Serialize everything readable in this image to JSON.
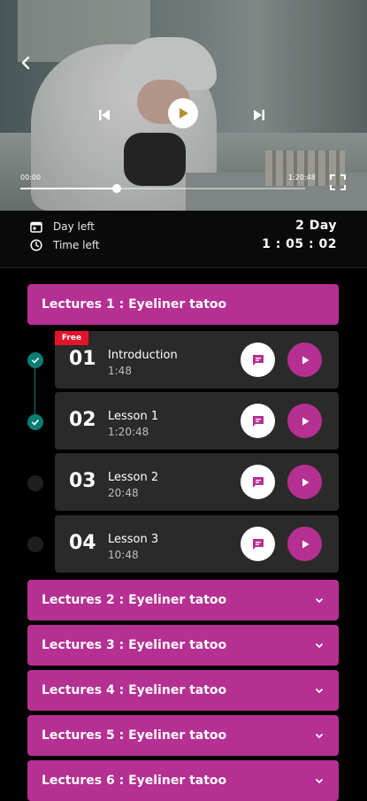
{
  "player": {
    "current_time": "00:00",
    "total_time": "1:20:48",
    "progress_fraction": 0.34
  },
  "info": {
    "day_left_label": "Day left",
    "day_left_value": "2  Day",
    "time_left_label": "Time left",
    "time_left_value": "1 : 05 : 02"
  },
  "expanded_section": {
    "title": "Lectures 1 : Eyeliner tatoo",
    "free_badge": "Free",
    "lessons": [
      {
        "number": "01",
        "title": "Introduction",
        "duration": "1:48",
        "completed": true
      },
      {
        "number": "02",
        "title": "Lesson 1",
        "duration": "1:20:48",
        "completed": true
      },
      {
        "number": "03",
        "title": "Lesson 2",
        "duration": "20:48",
        "completed": false
      },
      {
        "number": "04",
        "title": "Lesson 3",
        "duration": "10:48",
        "completed": false
      }
    ]
  },
  "collapsed_sections": [
    {
      "title": "Lectures 2 : Eyeliner tatoo"
    },
    {
      "title": "Lectures 3 : Eyeliner tatoo"
    },
    {
      "title": "Lectures 4 : Eyeliner tatoo"
    },
    {
      "title": "Lectures 5 : Eyeliner tatoo"
    },
    {
      "title": "Lectures 6 : Eyeliner tatoo"
    }
  ],
  "colors": {
    "accent": "#b62f93",
    "completed": "#0b7d73",
    "free_badge": "#e5132a",
    "card": "#2a2a2a"
  },
  "icons": [
    "back-arrow-icon",
    "skip-previous-icon",
    "play-icon",
    "skip-next-icon",
    "fullscreen-icon",
    "calendar-icon",
    "clock-icon",
    "check-icon",
    "chat-icon",
    "chevron-down-icon"
  ]
}
